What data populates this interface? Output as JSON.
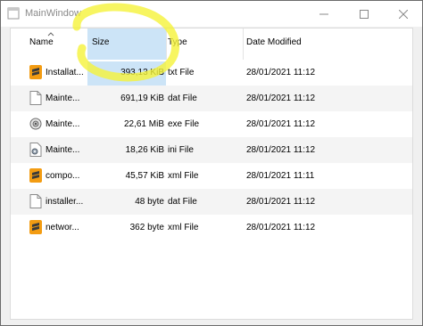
{
  "window": {
    "title": "MainWindow"
  },
  "title_buttons": {
    "minimize": "—",
    "maximize": "□",
    "close": "✕"
  },
  "columns": {
    "name": "Name",
    "size": "Size",
    "type": "Type",
    "date": "Date Modified"
  },
  "files": [
    {
      "name": "Installat...",
      "size": "393,13 KiB",
      "type": "txt File",
      "date": "28/01/2021 11:12",
      "icon": "sublime-icon"
    },
    {
      "name": "Mainte...",
      "size": "691,19 KiB",
      "type": "dat File",
      "date": "28/01/2021 11:12",
      "icon": "blank-file-icon"
    },
    {
      "name": "Mainte...",
      "size": "22,61 MiB",
      "type": "exe File",
      "date": "28/01/2021 11:12",
      "icon": "executable-icon"
    },
    {
      "name": "Mainte...",
      "size": "18,26 KiB",
      "type": "ini File",
      "date": "28/01/2021 11:12",
      "icon": "settings-file-icon"
    },
    {
      "name": "compo...",
      "size": "45,57 KiB",
      "type": "xml File",
      "date": "28/01/2021 11:11",
      "icon": "sublime-icon"
    },
    {
      "name": "installer...",
      "size": "48 byte",
      "type": "dat File",
      "date": "28/01/2021 11:12",
      "icon": "blank-file-icon"
    },
    {
      "name": "networ...",
      "size": "362 byte",
      "type": "xml File",
      "date": "28/01/2021 11:12",
      "icon": "sublime-icon"
    }
  ],
  "colors": {
    "highlight": "#cce4f7",
    "annotation": "#f5f23a",
    "sublime": "#f39c12"
  }
}
